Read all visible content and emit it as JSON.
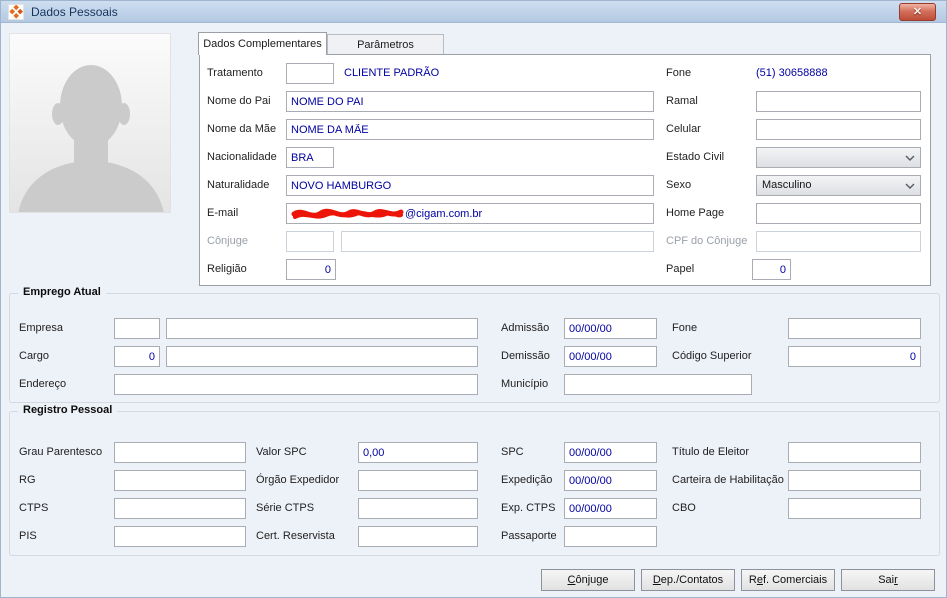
{
  "window": {
    "title": "Dados Pessoais",
    "close_glyph": "✕"
  },
  "tabs": {
    "active": "Dados Complementares",
    "inactive": "Parâmetros"
  },
  "personal": {
    "tratamento": {
      "label": "Tratamento",
      "value": "",
      "display": "CLIENTE PADRÃO"
    },
    "fone": {
      "label": "Fone",
      "value": "(51) 30658888"
    },
    "nome_pai": {
      "label": "Nome do Pai",
      "value": "NOME DO PAI"
    },
    "ramal": {
      "label": "Ramal",
      "value": ""
    },
    "nome_mae": {
      "label": "Nome da Mãe",
      "value": "NOME DA MÃE"
    },
    "celular": {
      "label": "Celular",
      "value": ""
    },
    "nacionalidade": {
      "label": "Nacionalidade",
      "value": "BRA"
    },
    "estado_civil": {
      "label": "Estado Civil",
      "value": ""
    },
    "naturalidade": {
      "label": "Naturalidade",
      "value": "NOVO HAMBURGO"
    },
    "sexo": {
      "label": "Sexo",
      "value": "Masculino"
    },
    "email": {
      "label": "E-mail",
      "visible_value": "@cigam.com.br"
    },
    "home_page": {
      "label": "Home Page",
      "value": ""
    },
    "conjuge": {
      "label": "Cônjuge",
      "code": "",
      "name": ""
    },
    "cpf_conjuge": {
      "label": "CPF do Cônjuge",
      "value": ""
    },
    "religiao": {
      "label": "Religião",
      "value": "0"
    },
    "papel": {
      "label": "Papel",
      "value": "0"
    }
  },
  "emprego_atual": {
    "title": "Emprego Atual",
    "empresa": {
      "label": "Empresa",
      "code": "",
      "name": ""
    },
    "admissao": {
      "label": "Admissão",
      "value": "00/00/00"
    },
    "fone": {
      "label": "Fone",
      "value": ""
    },
    "cargo": {
      "label": "Cargo",
      "code": "0",
      "name": ""
    },
    "demissao": {
      "label": "Demissão",
      "value": "00/00/00"
    },
    "codigo_superior": {
      "label": "Código Superior",
      "value": "0"
    },
    "endereco": {
      "label": "Endereço",
      "value": ""
    },
    "municipio": {
      "label": "Município",
      "value": ""
    }
  },
  "registro_pessoal": {
    "title": "Registro Pessoal",
    "grau_parentesco": {
      "label": "Grau Parentesco",
      "value": ""
    },
    "valor_spc": {
      "label": "Valor SPC",
      "value": "0,00"
    },
    "spc": {
      "label": "SPC",
      "value": "00/00/00"
    },
    "titulo_eleitor": {
      "label": "Título de Eleitor",
      "value": ""
    },
    "rg": {
      "label": "RG",
      "value": ""
    },
    "orgao_expedidor": {
      "label": "Órgão Expedidor",
      "value": ""
    },
    "expedicao": {
      "label": "Expedição",
      "value": "00/00/00"
    },
    "carteira_habilitacao": {
      "label": "Carteira de Habilitação",
      "value": ""
    },
    "ctps": {
      "label": "CTPS",
      "value": ""
    },
    "serie_ctps": {
      "label": "Série CTPS",
      "value": ""
    },
    "exp_ctps": {
      "label": "Exp. CTPS",
      "value": "00/00/00"
    },
    "cbo": {
      "label": "CBO",
      "value": ""
    },
    "pis": {
      "label": "PIS",
      "value": ""
    },
    "cert_reservista": {
      "label": "Cert. Reservista",
      "value": ""
    },
    "passaporte": {
      "label": "Passaporte",
      "value": ""
    }
  },
  "buttons": {
    "conjuge": {
      "pre": "",
      "accel": "C",
      "post": "ônjuge"
    },
    "dep_contatos": {
      "pre": "",
      "accel": "D",
      "post": "ep./Contatos"
    },
    "ref_comerciais": {
      "pre": "R",
      "accel": "e",
      "post": "f. Comerciais"
    },
    "sair": {
      "pre": "Sai",
      "accel": "r",
      "post": ""
    }
  },
  "colors": {
    "field_text": "#0000a0",
    "titlebar": "#bccfe7",
    "redaction": "#ec1507",
    "logo_orange": "#e66a1e"
  }
}
